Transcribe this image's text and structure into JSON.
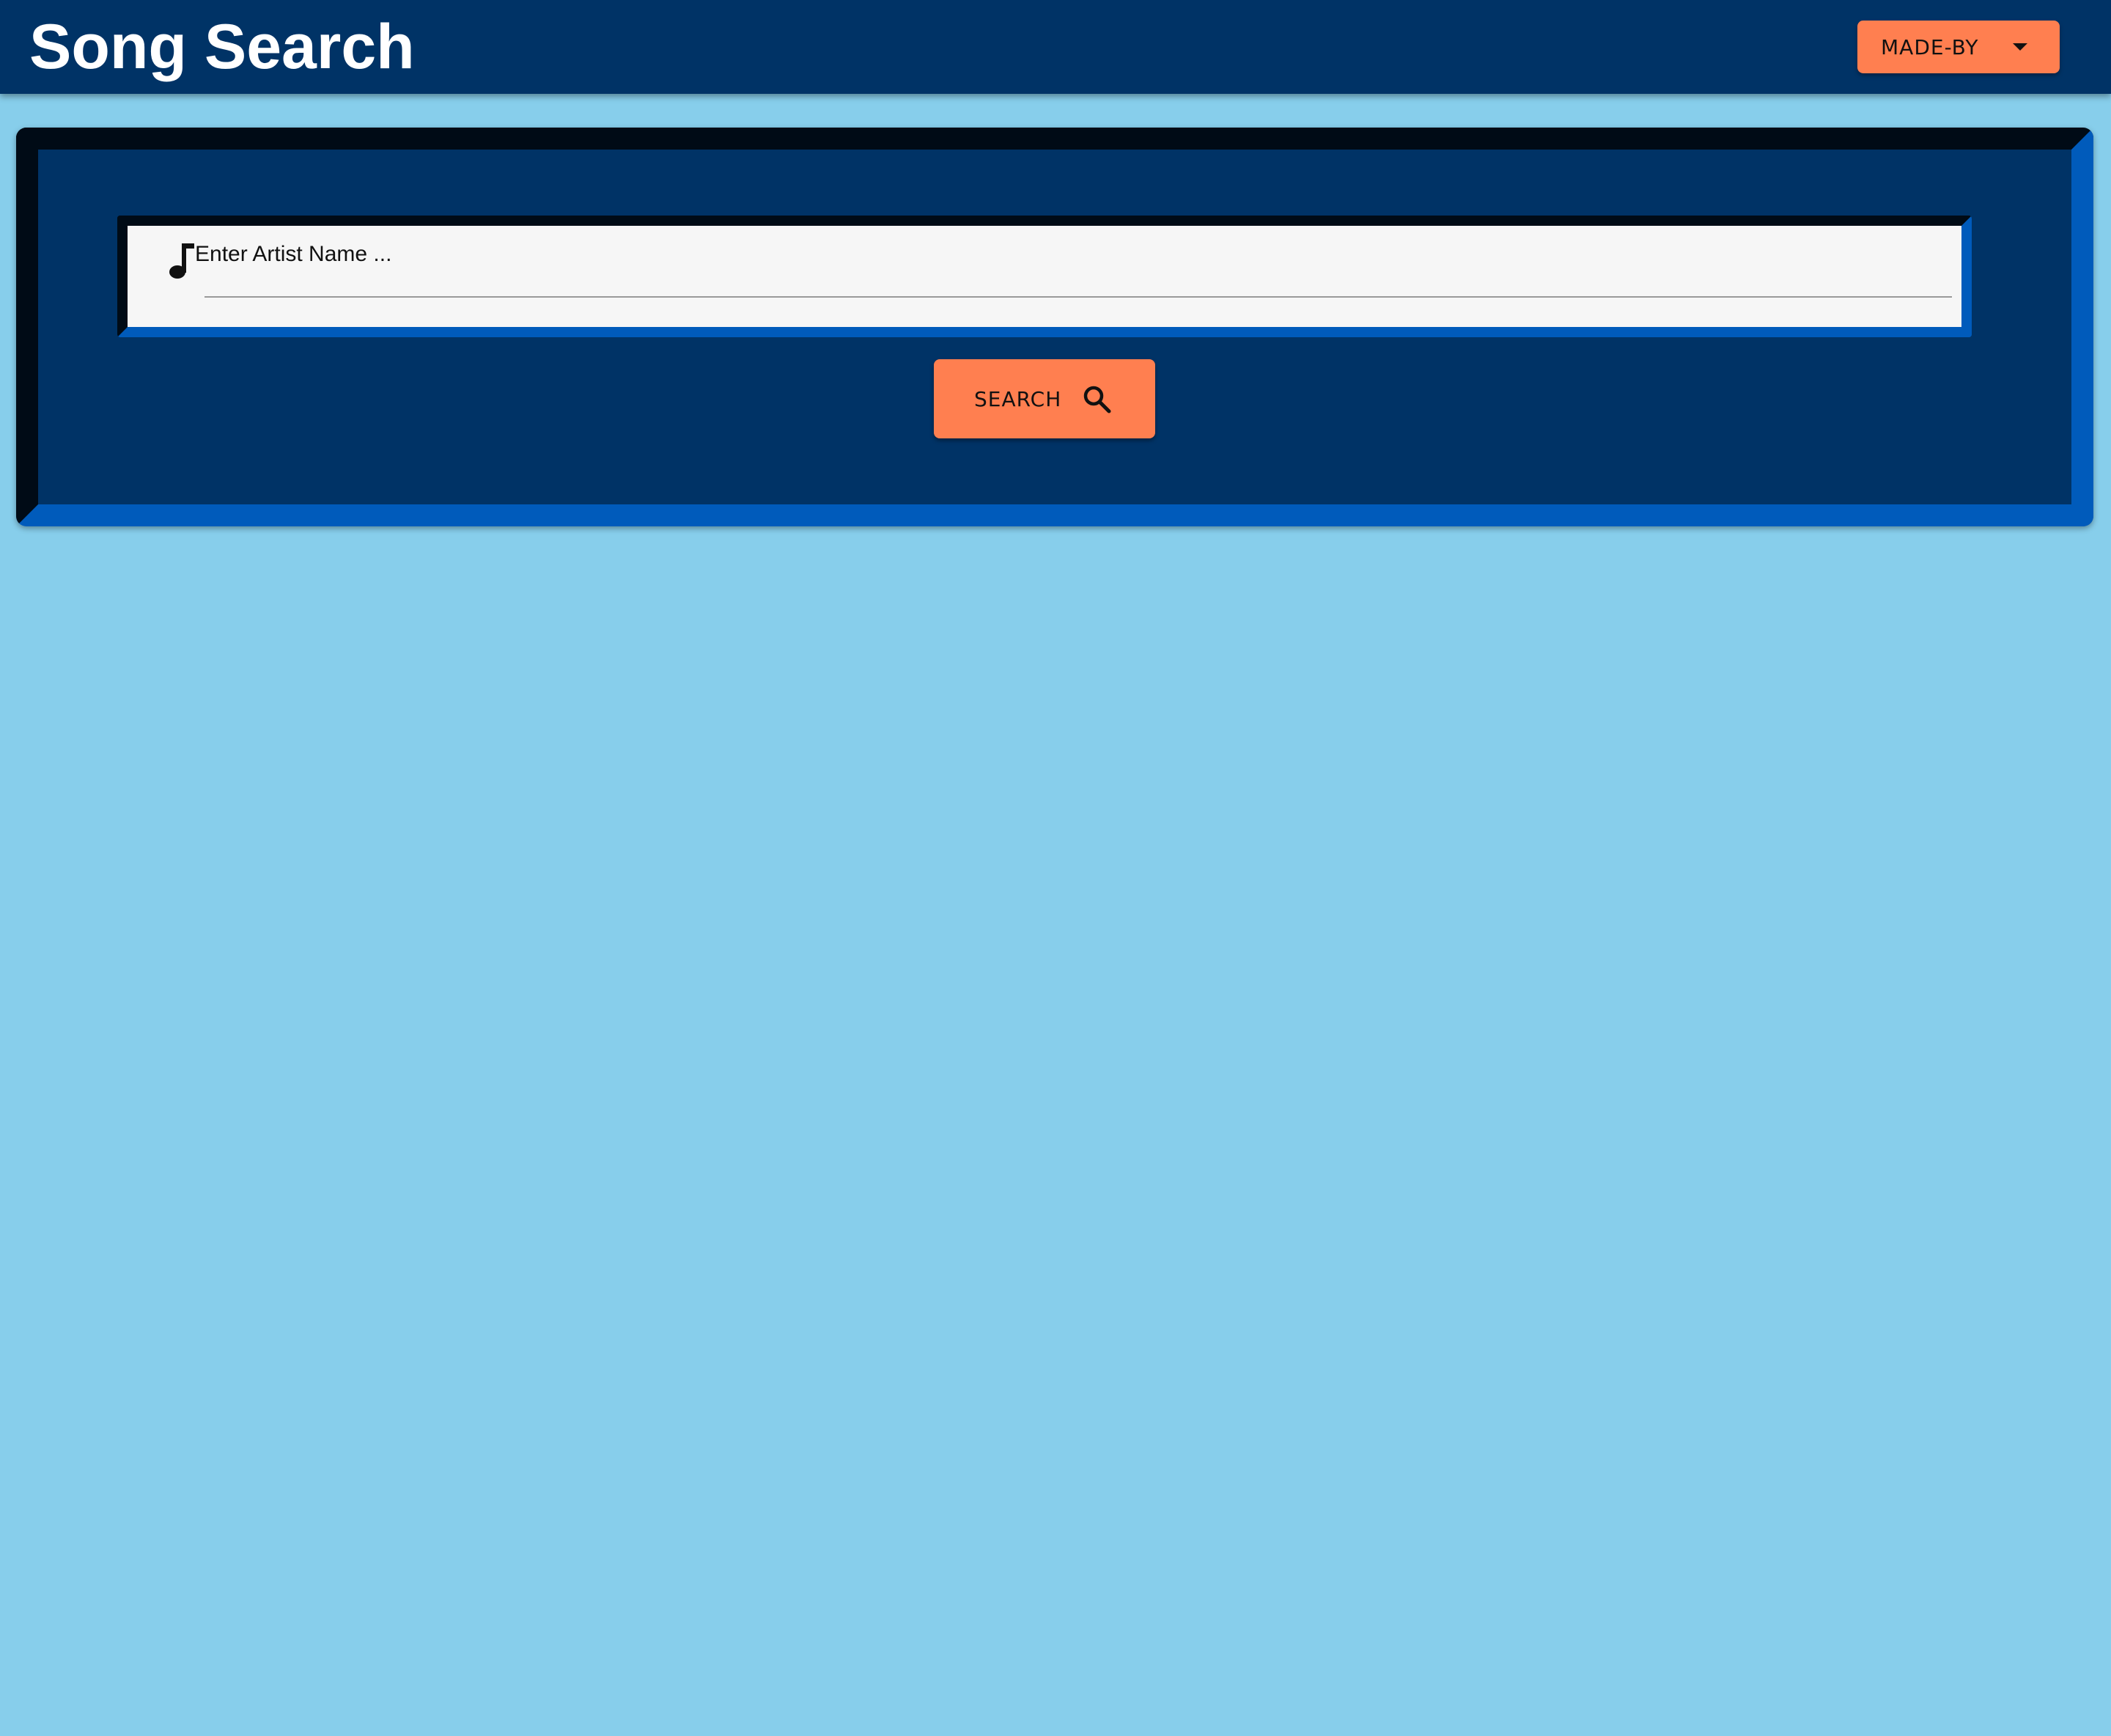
{
  "header": {
    "title": "Song Search",
    "made_by_label": "MADE-BY"
  },
  "search": {
    "placeholder": "Enter Artist Name ...",
    "value": "",
    "button_label": "SEARCH"
  },
  "icons": {
    "field_icon": "music-note-icon",
    "button_icon": "search-icon",
    "dropdown_icon": "caret-down-icon"
  },
  "colors": {
    "page_background": "#87ceeb",
    "app_bar": "#003366",
    "accent": "#ff7f50",
    "panel_bevel_dark": "#000b16",
    "panel_bevel_light": "#005bbb"
  }
}
